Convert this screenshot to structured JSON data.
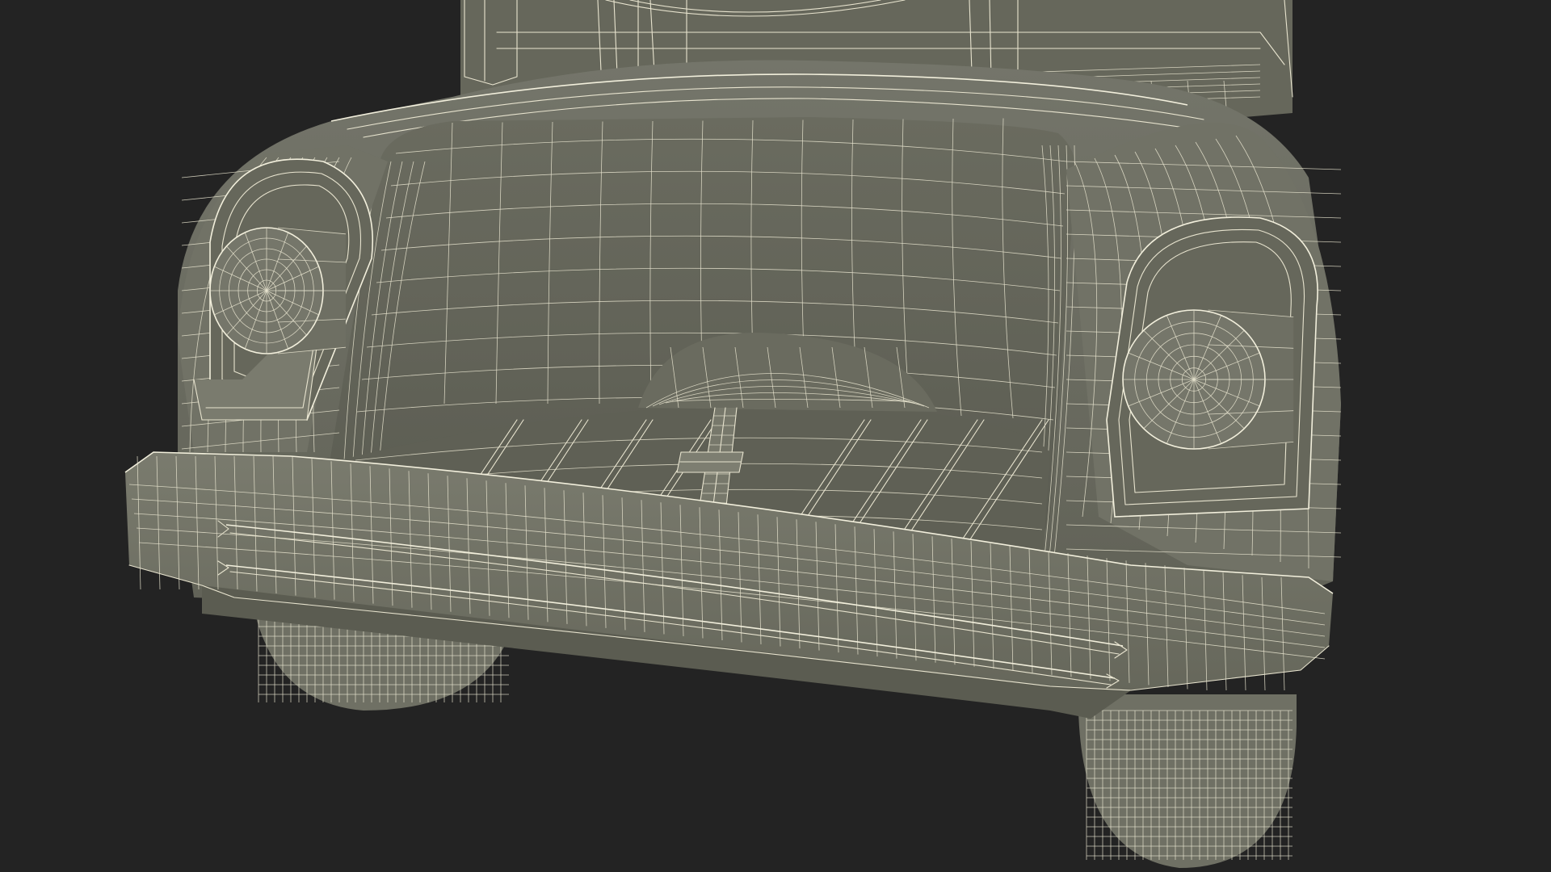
{
  "scene": {
    "background_color": "#232323",
    "mesh_fill_color": "#6d6e62",
    "mesh_fill_dark": "#5e5f54",
    "mesh_fill_light": "#77786b",
    "wire_color": "#e8e4cf",
    "render_mode": "wireframe-on-shaded"
  }
}
